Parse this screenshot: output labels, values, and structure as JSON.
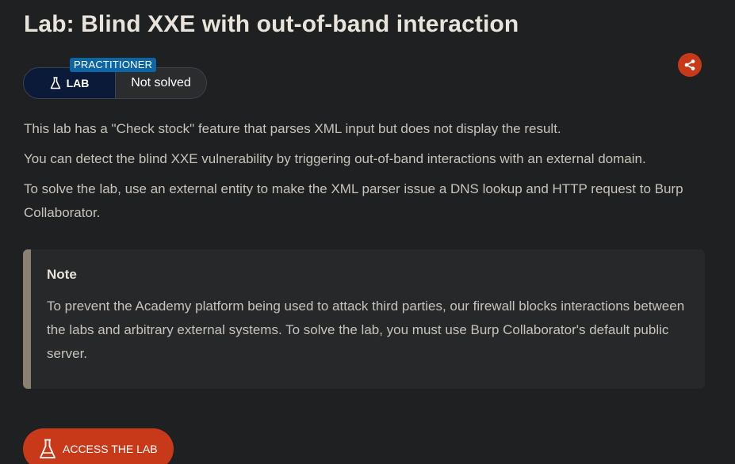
{
  "lab": {
    "title": "Lab: Blind XXE with out-of-band interaction",
    "level": "PRACTITIONER",
    "badge_label": "LAB",
    "status": "Not solved"
  },
  "description": [
    "This lab has a \"Check stock\" feature that parses XML input but does not display the result.",
    "You can detect the blind XXE vulnerability by triggering out-of-band interactions with an external domain.",
    "To solve the lab, use an external entity to make the XML parser issue a DNS lookup and HTTP request to Burp Collaborator."
  ],
  "note": {
    "title": "Note",
    "text": "To prevent the Academy platform being used to attack third parties, our firewall blocks interactions between the labs and arbitrary external systems. To solve the lab, you must use Burp Collaborator's default public server."
  },
  "actions": {
    "access_lab_label": "ACCESS THE LAB"
  },
  "icons": {
    "share": "share-icon",
    "flask": "flask-icon"
  },
  "colors": {
    "accent": "#c8391a",
    "level_tag": "#0c66a6",
    "badge_bg": "#0c1a3a",
    "page_bg": "#1f2021"
  }
}
